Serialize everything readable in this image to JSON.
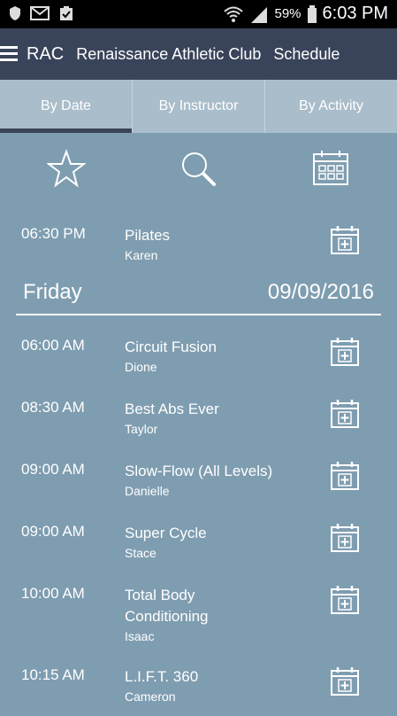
{
  "status": {
    "battery_text": "59%",
    "time": "6:03 PM"
  },
  "appbar": {
    "short_name": "RAC",
    "club_name": "Renaissance Athletic Club",
    "section": "Schedule"
  },
  "tabs": [
    {
      "label": "By Date",
      "active": true
    },
    {
      "label": "By Instructor",
      "active": false
    },
    {
      "label": "By Activity",
      "active": false
    }
  ],
  "toolbar": {
    "icons": [
      "star-icon",
      "search-icon",
      "calendar-icon"
    ]
  },
  "schedule": {
    "first": {
      "time": "06:30 PM",
      "name": "Pilates",
      "instructor": "Karen"
    },
    "day": "Friday",
    "date": "09/09/2016",
    "items": [
      {
        "time": "06:00 AM",
        "name": "Circuit Fusion",
        "instructor": "Dione"
      },
      {
        "time": "08:30 AM",
        "name": "Best Abs Ever",
        "instructor": "Taylor"
      },
      {
        "time": "09:00 AM",
        "name": "Slow-Flow (All Levels)",
        "instructor": "Danielle"
      },
      {
        "time": "09:00 AM",
        "name": "Super Cycle",
        "instructor": "Stace"
      },
      {
        "time": "10:00 AM",
        "name": "Total Body Conditioning",
        "instructor": "Isaac"
      },
      {
        "time": "10:15 AM",
        "name": "L.I.F.T. 360",
        "instructor": "Cameron"
      }
    ]
  }
}
